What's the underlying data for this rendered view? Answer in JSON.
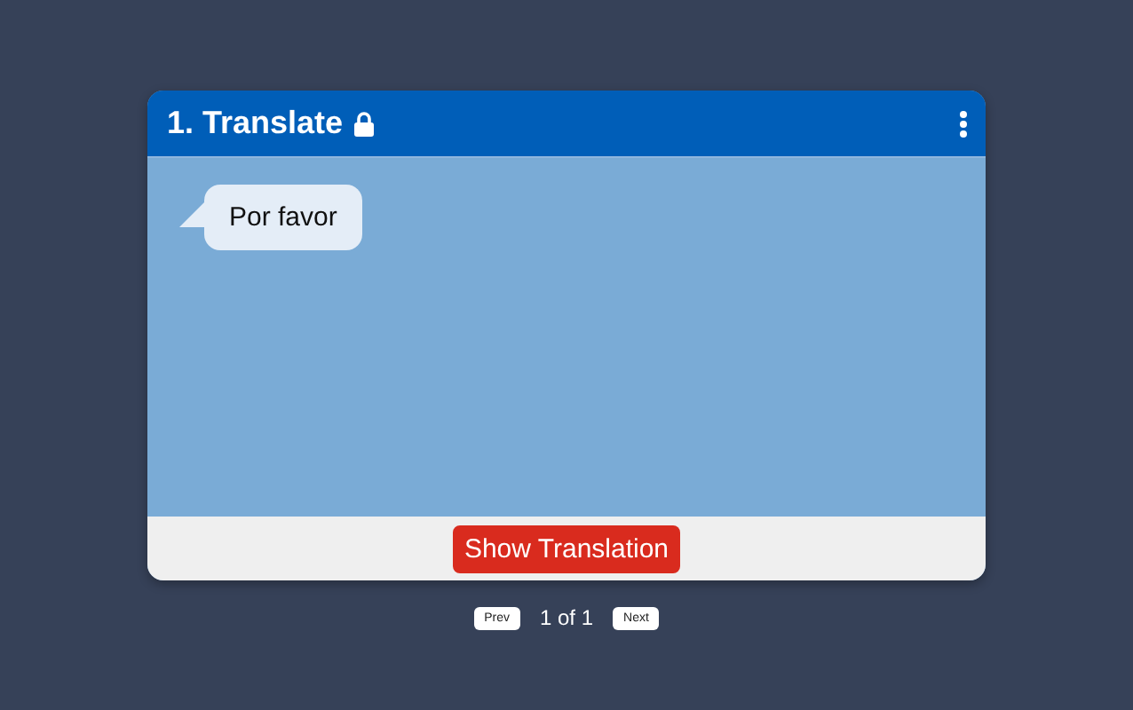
{
  "card": {
    "title": "1. Translate",
    "locked": true,
    "message": "Por favor",
    "button": "Show Translation"
  },
  "pager": {
    "prev": "Prev",
    "status": "1 of 1",
    "next": "Next"
  }
}
